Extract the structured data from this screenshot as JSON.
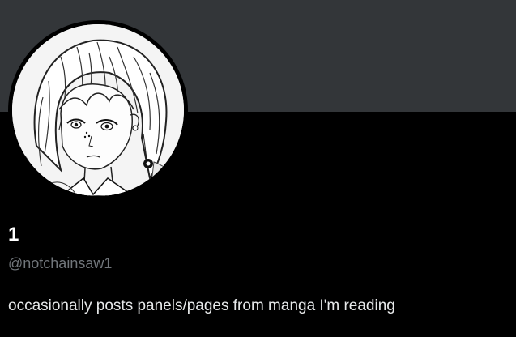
{
  "profile": {
    "display_name": "1",
    "handle": "@notchainsaw1",
    "bio": "occasionally posts panels/pages from manga I'm reading"
  },
  "colors": {
    "banner": "#333639",
    "background": "#000000",
    "display_name": "#ffffff",
    "handle": "#71767b",
    "bio": "#e7e9ea"
  },
  "icons": {
    "avatar": "manga-character-avatar"
  }
}
